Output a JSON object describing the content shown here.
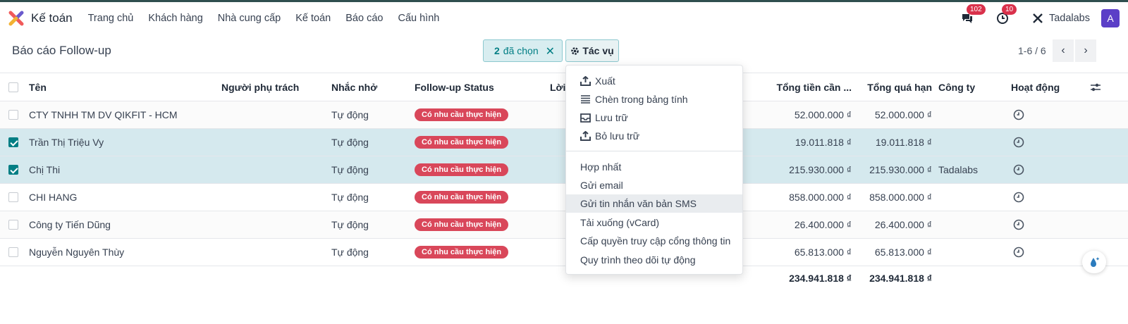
{
  "navbar": {
    "app_title": "Kế toán",
    "menus": [
      "Trang chủ",
      "Khách hàng",
      "Nhà cung cấp",
      "Kế toán",
      "Báo cáo",
      "Cấu hình"
    ],
    "messages_count": "102",
    "activities_count": "10",
    "company": "Tadalabs",
    "avatar_letter": "A"
  },
  "control": {
    "breadcrumb": "Báo cáo Follow-up",
    "selected_count": "2",
    "selected_label": "đã chọn",
    "actions_label": "Tác vụ",
    "pager": "1-6 / 6"
  },
  "columns": {
    "name": "Tên",
    "responsible": "Người phụ trách",
    "reminder": "Nhắc nhở",
    "status": "Follow-up Status",
    "loi": "Lời",
    "total_due": "Tổng tiền cần ...",
    "total_overdue": "Tổng quá hạn",
    "company": "Công ty",
    "activity": "Hoạt động"
  },
  "rows": [
    {
      "name": "CTY TNHH TM DV QIKFIT - HCM",
      "reminder": "Tự động",
      "status": "Có nhu cầu thực hiện",
      "total_due": "52.000.000 ₫",
      "total_overdue": "52.000.000 ₫",
      "company": "",
      "selected": false
    },
    {
      "name": "Trần Thị Triệu Vy",
      "reminder": "Tự động",
      "status": "Có nhu cầu thực hiện",
      "total_due": "19.011.818 ₫",
      "total_overdue": "19.011.818 ₫",
      "company": "",
      "selected": true
    },
    {
      "name": "Chị Thi",
      "reminder": "Tự động",
      "status": "Có nhu cầu thực hiện",
      "total_due": "215.930.000 ₫",
      "total_overdue": "215.930.000 ₫",
      "company": "Tadalabs",
      "selected": true
    },
    {
      "name": "CHI HANG",
      "reminder": "Tự động",
      "status": "Có nhu cầu thực hiện",
      "total_due": "858.000.000 ₫",
      "total_overdue": "858.000.000 ₫",
      "company": "",
      "selected": false
    },
    {
      "name": "Công ty Tiến Dũng",
      "reminder": "Tự động",
      "status": "Có nhu cầu thực hiện",
      "total_due": "26.400.000 ₫",
      "total_overdue": "26.400.000 ₫",
      "company": "",
      "selected": false
    },
    {
      "name": "Nguyễn Nguyên Thùy",
      "reminder": "Tự động",
      "status": "Có nhu cầu thực hiện",
      "total_due": "65.813.000 ₫",
      "total_overdue": "65.813.000 ₫",
      "company": "",
      "selected": false
    }
  ],
  "totals": {
    "total_due": "234.941.818 ₫",
    "total_overdue": "234.941.818 ₫"
  },
  "actions_menu": {
    "group1": [
      "Xuất",
      "Chèn trong bảng tính",
      "Lưu trữ",
      "Bỏ lưu trữ"
    ],
    "group2": [
      "Hợp nhất",
      "Gửi email",
      "Gửi tin nhắn văn bản SMS",
      "Tải xuống (vCard)",
      "Cấp quyền truy cập cổng thông tin",
      "Quy trình theo dõi tự động"
    ]
  },
  "colors": {
    "brand_teal": "#017e84",
    "selected_row": "#d5e9ee",
    "status_red": "#d9475a",
    "badge_red": "#d9314b",
    "avatar_purple": "#5b3fc7"
  }
}
